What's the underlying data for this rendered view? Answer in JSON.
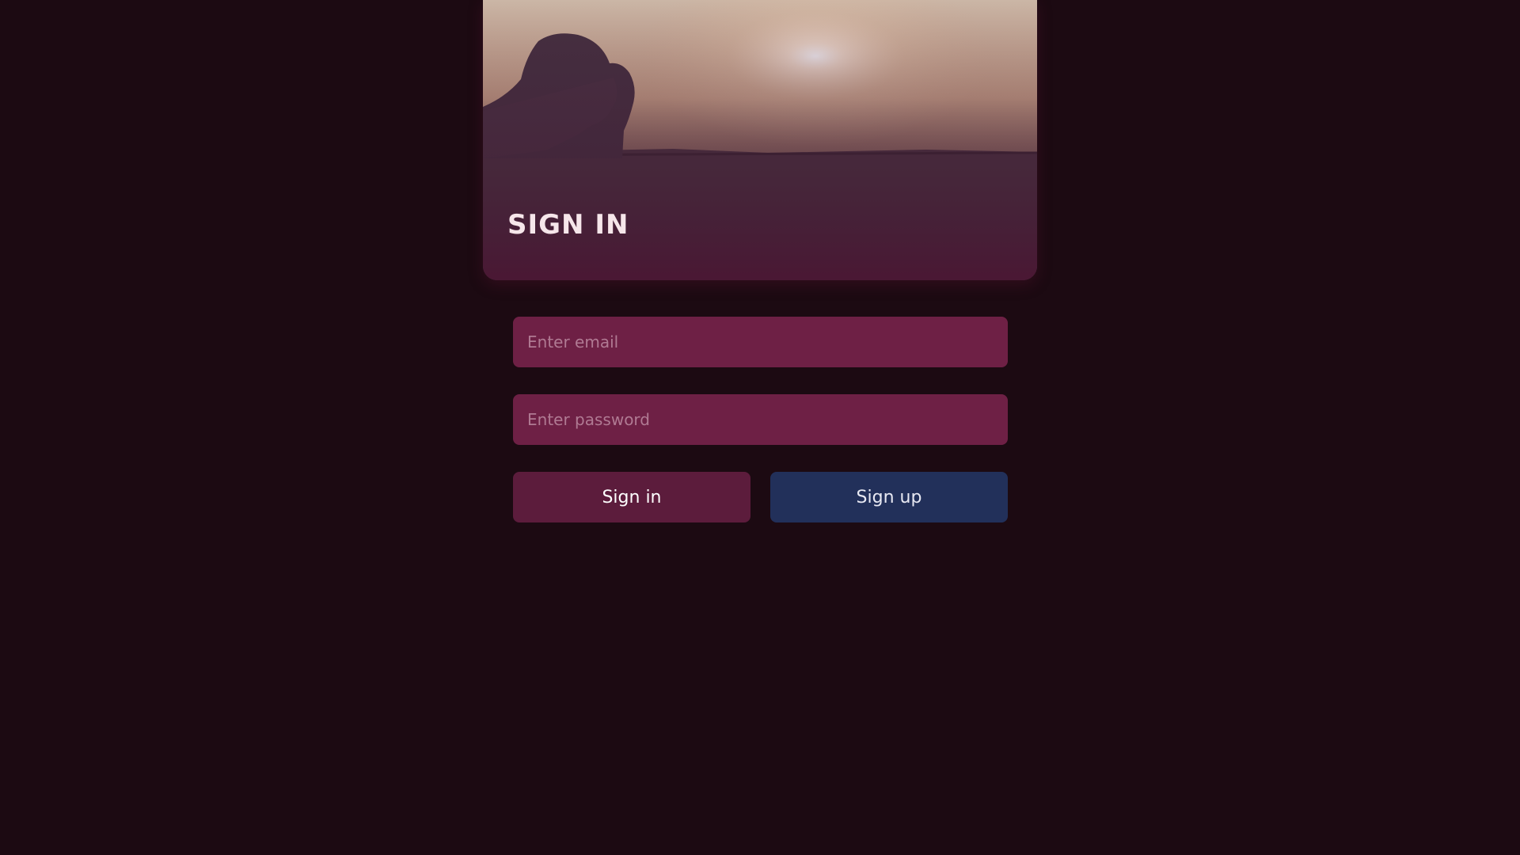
{
  "hero": {
    "title": "SIGN IN"
  },
  "form": {
    "email_placeholder": "Enter email",
    "password_placeholder": "Enter password",
    "signin_label": "Sign in",
    "signup_label": "Sign up"
  },
  "colors": {
    "background": "#1c0a12",
    "input_fill": "#6e2045",
    "signin_button": "#5c1c3c",
    "signup_button": "#22305a"
  }
}
